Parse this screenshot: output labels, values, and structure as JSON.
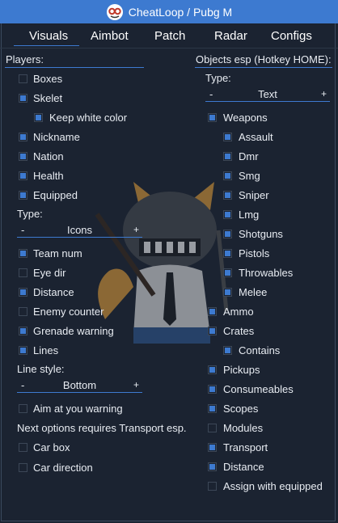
{
  "window": {
    "title": "CheatLoop / Pubg M"
  },
  "tabs": [
    {
      "label": "Visuals",
      "active": true
    },
    {
      "label": "Aimbot"
    },
    {
      "label": "Patch"
    },
    {
      "label": "Radar"
    },
    {
      "label": "Configs"
    }
  ],
  "players": {
    "header": "Players:",
    "boxes": "Boxes",
    "skelet": "Skelet",
    "keep_white_color": "Keep white color",
    "nickname": "Nickname",
    "nation": "Nation",
    "health": "Health",
    "equipped": "Equipped",
    "type_label": "Type:",
    "type_combo": {
      "minus": "-",
      "value": "Icons",
      "plus": "+"
    },
    "team_num": "Team num",
    "eye_dir": "Eye dir",
    "distance": "Distance",
    "enemy_counter": "Enemy counter",
    "grenade_warning": "Grenade warning",
    "lines": "Lines",
    "line_style_label": "Line style:",
    "line_style_combo": {
      "minus": "-",
      "value": "Bottom",
      "plus": "+"
    },
    "aim_warning": "Aim at you warning",
    "transport_note": "Next options requires Transport esp.",
    "car_box": "Car box",
    "car_direction": "Car direction"
  },
  "objects": {
    "header": "Objects esp (Hotkey HOME):",
    "type_label": "Type:",
    "type_combo": {
      "minus": "-",
      "value": "Text",
      "plus": "+"
    },
    "weapons": "Weapons",
    "assault": "Assault",
    "dmr": "Dmr",
    "smg": "Smg",
    "sniper": "Sniper",
    "lmg": "Lmg",
    "shotguns": "Shotguns",
    "pistols": "Pistols",
    "throwables": "Throwables",
    "melee": "Melee",
    "ammo": "Ammo",
    "crates": "Crates",
    "contains": "Contains",
    "pickups": "Pickups",
    "consumeables": "Consumeables",
    "scopes": "Scopes",
    "modules": "Modules",
    "transport": "Transport",
    "distance": "Distance",
    "assign_equipped": "Assign with equipped"
  },
  "checked": {
    "boxes": false,
    "skelet": true,
    "keep_white_color": true,
    "nickname": true,
    "nation": true,
    "health": true,
    "equipped": true,
    "team_num": true,
    "eye_dir": false,
    "distance": true,
    "enemy_counter": false,
    "grenade_warning": true,
    "lines": true,
    "aim_warning": false,
    "car_box": false,
    "car_direction": false,
    "weapons": true,
    "assault": true,
    "dmr": true,
    "smg": true,
    "sniper": true,
    "lmg": true,
    "shotguns": true,
    "pistols": true,
    "throwables": true,
    "melee": true,
    "ammo": true,
    "crates": true,
    "contains": true,
    "pickups": true,
    "consumeables": true,
    "scopes": true,
    "modules": false,
    "transport": true,
    "obj_distance": true,
    "assign_equipped": false
  },
  "colors": {
    "accent": "#3d7ad0",
    "panel": "#1b2331",
    "text": "#e8ecf2"
  }
}
